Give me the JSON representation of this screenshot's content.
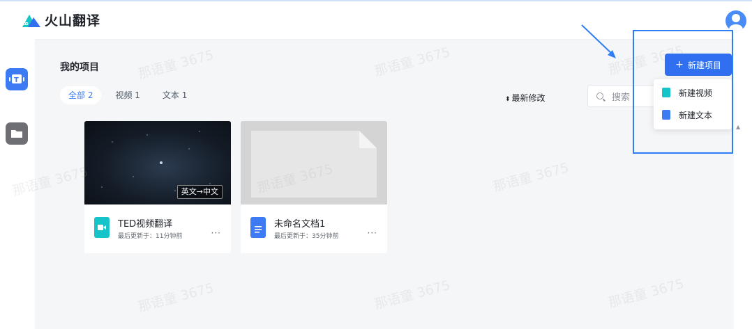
{
  "app": {
    "name": "火山翻译"
  },
  "page": {
    "title": "我的项目"
  },
  "tabs": [
    {
      "label": "全部 2",
      "active": true
    },
    {
      "label": "视频 1",
      "active": false
    },
    {
      "label": "文本 1",
      "active": false
    }
  ],
  "sort": {
    "icon": "sort-arrows-icon",
    "label": "最新修改"
  },
  "search": {
    "placeholder": "搜索"
  },
  "new_button": {
    "label": "新建项目"
  },
  "dropdown": {
    "items": [
      {
        "label": "新建视频",
        "icon": "video-file-icon"
      },
      {
        "label": "新建文本",
        "icon": "doc-file-icon"
      }
    ]
  },
  "projects": [
    {
      "name": "TED视频翻译",
      "updated": "最后更新于：11分钟前",
      "tag": "英文→中文",
      "type": "video"
    },
    {
      "name": "未命名文档1",
      "updated": "最后更新于：35分钟前",
      "type": "doc"
    }
  ],
  "watermark": "那语童 3675",
  "colors": {
    "accent": "#2f6ff0",
    "video_teal": "#14c4c8",
    "doc_blue": "#3d7bf5",
    "annotation": "#2e7df5"
  }
}
